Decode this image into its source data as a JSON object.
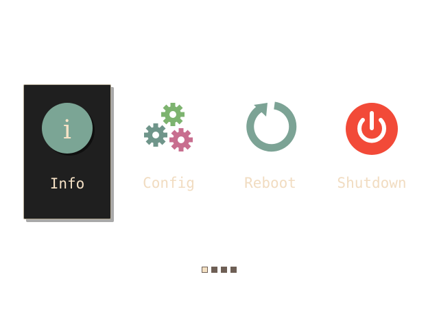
{
  "menu": {
    "items": [
      {
        "label": "Info",
        "icon": "info-icon",
        "selected": true
      },
      {
        "label": "Config",
        "icon": "gears-icon",
        "selected": false
      },
      {
        "label": "Reboot",
        "icon": "reboot-icon",
        "selected": false
      },
      {
        "label": "Shutdown",
        "icon": "power-icon",
        "selected": false
      }
    ],
    "info_glyph": "i"
  },
  "pager": {
    "total_pages": 4,
    "current_page": 1
  },
  "colors": {
    "selected_bg": "#1f1f1f",
    "label_color": "#f1dcc1",
    "info_circle": "#7ba595",
    "gear_green": "#7db36f",
    "gear_teal": "#6f958a",
    "gear_pink": "#c86e8f",
    "reboot": "#7ca395",
    "power": "#f24a38",
    "pager_dot": "#6e5f55",
    "pager_active": "#f3e0c3"
  }
}
